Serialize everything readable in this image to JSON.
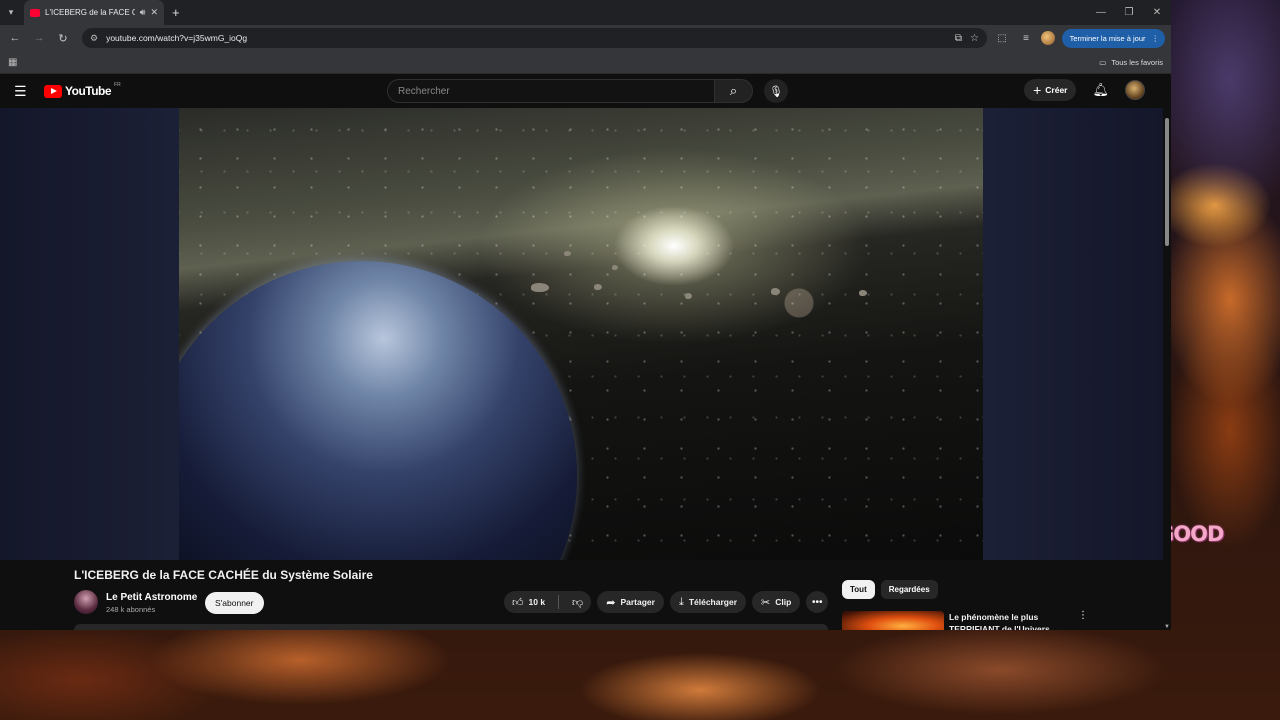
{
  "browser": {
    "tab_title": "L'ICEBERG de la FACE CACHÉE du Système Solaire - YouTube",
    "url": "youtube.com/watch?v=j35wmG_ioQg",
    "update_button": "Terminer la mise à jour",
    "bookmarks_folder": "Tous les favoris"
  },
  "youtube": {
    "logo_text": "YouTube",
    "region": "FR",
    "search_placeholder": "Rechercher",
    "create_label": "Créer",
    "video": {
      "title": "L'ICEBERG de la FACE CACHÉE du Système Solaire",
      "channel": "Le Petit Astronome",
      "subscribers": "248 k abonnés",
      "subscribe_label": "S'abonner",
      "likes": "10 k",
      "share_label": "Partager",
      "download_label": "Télécharger",
      "clip_label": "Clip"
    },
    "chips": [
      "Tout",
      "Regardées"
    ],
    "recommendation": {
      "title": "Le phénomène le plus TERRIFIANT de l'Univers"
    }
  },
  "desktop": {
    "sticker_text": "GOOD"
  },
  "icons": {
    "tab_list": "chevron-down-icon",
    "audio": "speaker-icon",
    "back": "arrow-left-icon",
    "forward": "arrow-right-icon",
    "reload": "reload-icon",
    "search": "search-icon",
    "mic": "mic-icon",
    "bell": "bell-icon"
  },
  "colors": {
    "yt_red": "#ff0000",
    "update_blue": "#1f5fa8",
    "background": "#0f0f0f"
  }
}
